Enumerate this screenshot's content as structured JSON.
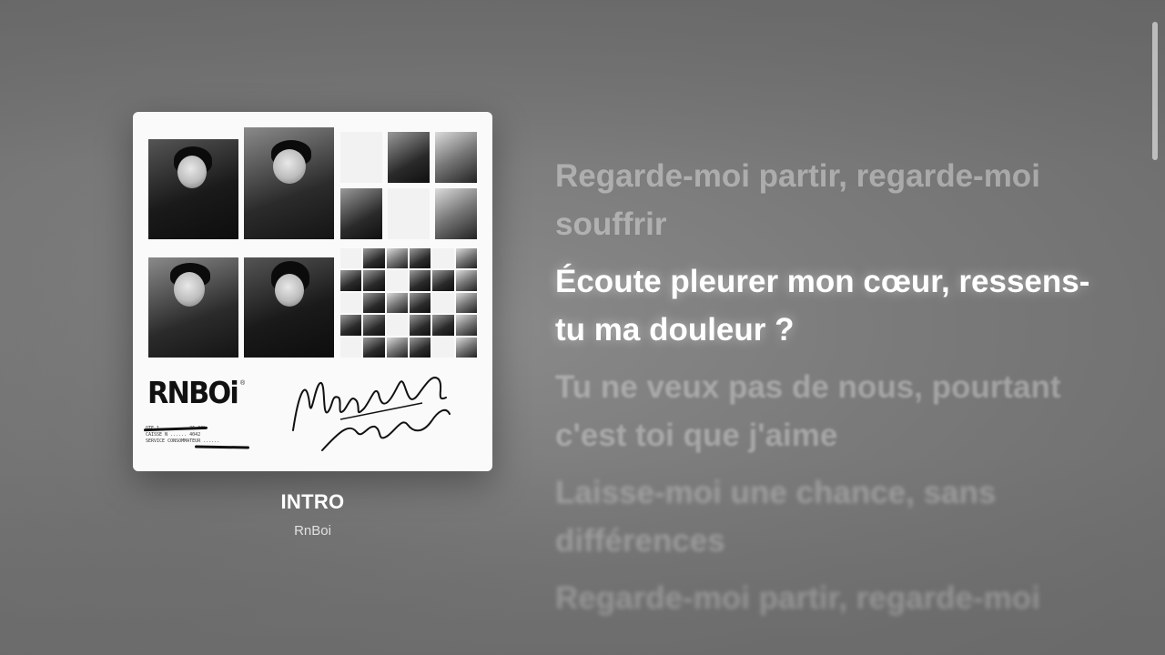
{
  "now_playing": {
    "title": "INTRO",
    "artist": "RnBoi"
  },
  "album_art": {
    "logo_text": "RNBOi",
    "registered_mark": "®",
    "script_text": "My Eyes Only Flashbacks",
    "receipt_lines": [
      "QTE 1 ......... 26.00%",
      "CAISSE N ...... 4042",
      "SERVICE CONSOMMATEUR ......"
    ]
  },
  "lyrics": {
    "lines": [
      {
        "text": "Regarde-moi partir, regarde-moi souffrir",
        "state": "past"
      },
      {
        "text": "Écoute pleurer mon cœur, ressens-tu ma douleur ?",
        "state": "active"
      },
      {
        "text": "Tu ne veux pas de nous, pourtant c'est toi que j'aime",
        "state": "upcoming"
      },
      {
        "text": "Laisse-moi une chance, sans différences",
        "state": "far"
      },
      {
        "text": "Regarde-moi partir, regarde-moi souffrir",
        "state": "cut"
      }
    ]
  },
  "scrollbar": {
    "position_fraction": 0.03
  }
}
